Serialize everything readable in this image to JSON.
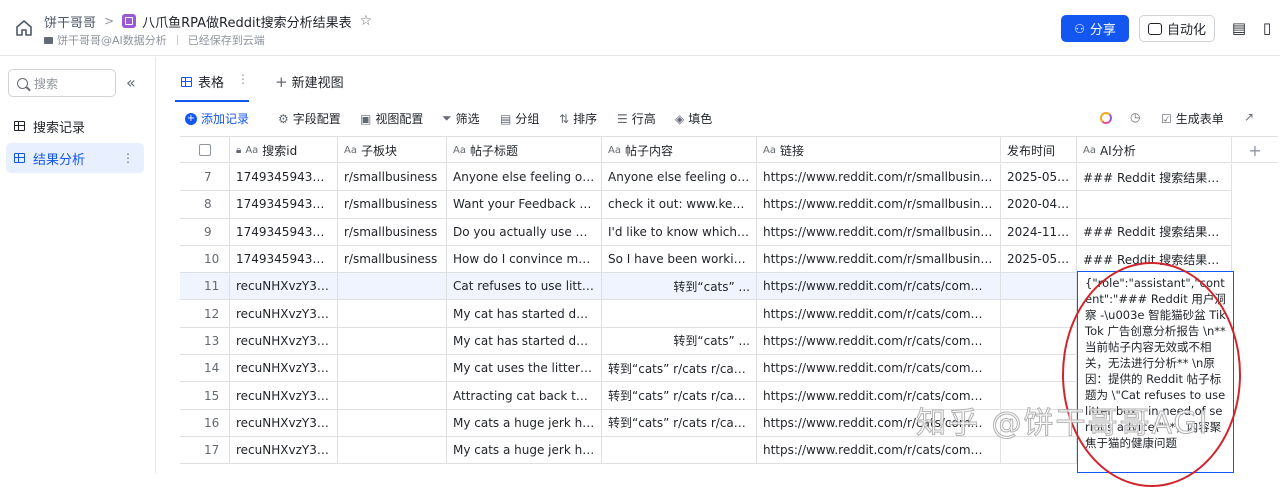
{
  "header": {
    "breadcrumb_parent": "饼干哥哥",
    "doc_title": "八爪鱼RPA做Reddit搜索分析结果表",
    "workspace": "饼干哥哥@AI数据分析",
    "save_status": "已经保存到云端",
    "share_label": "分享",
    "automation_label": "自动化",
    "accent": "#1456f0"
  },
  "sidebar": {
    "search_placeholder": "搜索",
    "items": [
      {
        "label": "搜索记录"
      },
      {
        "label": "结果分析"
      }
    ]
  },
  "tabs": {
    "table_label": "表格",
    "new_view_label": "新建视图"
  },
  "toolbar": {
    "add_record": "添加记录",
    "field_config": "字段配置",
    "view_config": "视图配置",
    "filter": "筛选",
    "group": "分组",
    "sort": "排序",
    "row_height": "行高",
    "fill_color": "填色",
    "generate_form": "生成表单"
  },
  "table": {
    "columns": [
      {
        "label": "搜索id",
        "type": "Aa"
      },
      {
        "label": "子板块",
        "type": "Aa"
      },
      {
        "label": "帖子标题",
        "type": "Aa"
      },
      {
        "label": "帖子内容",
        "type": "Aa"
      },
      {
        "label": "链接",
        "type": "Aa"
      },
      {
        "label": "发布时间",
        "type": ""
      },
      {
        "label": "AI分析",
        "type": "Aa"
      }
    ],
    "rows": [
      {
        "idx": "7",
        "search_id": "1749345943597",
        "subreddit": "r/smallbusiness",
        "title": "Anyone else feeling over...",
        "content": "Anyone else feeling over...",
        "link": "https://www.reddit.com/r/smallbusiness/...",
        "date": "2025-05-...",
        "ai": "### Reddit 搜索结果商..."
      },
      {
        "idx": "8",
        "search_id": "1749345943597",
        "subreddit": "r/smallbusiness",
        "title": "Want your Feedback - K...",
        "content": "check it out: www.keep...",
        "link": "https://www.reddit.com/r/smallbusiness/...",
        "date": "2020-04-...",
        "ai": ""
      },
      {
        "idx": "9",
        "search_id": "1749345943597",
        "subreddit": "r/smallbusiness",
        "title": "Do you actually use AI t...",
        "content": "I'd like to know which A...",
        "link": "https://www.reddit.com/r/smallbusiness/...",
        "date": "2024-11-...",
        "ai": "### Reddit 搜索结果商..."
      },
      {
        "idx": "10",
        "search_id": "1749345943597",
        "subreddit": "r/smallbusiness",
        "title": "How do I convince my b...",
        "content": "So I have been working ...",
        "link": "https://www.reddit.com/r/smallbusiness/...",
        "date": "2025-05-...",
        "ai": "### Reddit 搜索结果商..."
      },
      {
        "idx": "11",
        "search_id": "recuNHXvzY3sz5",
        "subreddit": "",
        "title": "Cat refuses to use litter ...",
        "content": "转到“cats” ...",
        "link": "https://www.reddit.com/r/cats/comment...",
        "date": "",
        "ai": ""
      },
      {
        "idx": "12",
        "search_id": "recuNHXvzY3sz5",
        "subreddit": "",
        "title": "My cat has started doin...",
        "content": "",
        "link": "https://www.reddit.com/r/cats/comment...",
        "date": "",
        "ai": ""
      },
      {
        "idx": "13",
        "search_id": "recuNHXvzY3sz5",
        "subreddit": "",
        "title": "My cat has started doin...",
        "content": "转到“cats” ...",
        "link": "https://www.reddit.com/r/cats/comment...",
        "date": "",
        "ai": ""
      },
      {
        "idx": "14",
        "search_id": "recuNHXvzY3sz5",
        "subreddit": "",
        "title": "My cat uses the litter bo...",
        "content": "转到“cats” r/cats r/cats ...",
        "link": "https://www.reddit.com/r/cats/comment...",
        "date": "",
        "ai": ""
      },
      {
        "idx": "15",
        "search_id": "recuNHXvzY3sz5",
        "subreddit": "",
        "title": "Attracting cat back to litt...",
        "content": "转到“cats” r/cats r/cats ...",
        "link": "https://www.reddit.com/r/cats/comment...",
        "date": "",
        "ai": ""
      },
      {
        "idx": "16",
        "search_id": "recuNHXvzY3sz5",
        "subreddit": "",
        "title": "My cats a huge jerk how...",
        "content": "转到“cats” r/cats r/cats ...",
        "link": "https://www.reddit.com/r/cats/comment...",
        "date": "",
        "ai": ""
      },
      {
        "idx": "17",
        "search_id": "recuNHXvzY3sz5",
        "subreddit": "",
        "title": "My cats a huge jerk how...",
        "content": "",
        "link": "https://www.reddit.com/r/cats/comment...",
        "date": "",
        "ai": ""
      }
    ],
    "expanded_ai_text": "{\"role\":\"assistant\",\"content\":\"### Reddit 用户洞察 -\\u003e 智能猫砂盆 TikTok 广告创意分析报告 \\n**当前帖子内容无效或不相关，无法进行分析** \\n原因：提供的 Reddit 帖子标题为 \\\"Cat refuses to use litter box - in need of serious advice\\\"**，内容聚焦于猫的健康问题"
  },
  "watermark": "知乎 @饼干哥哥AGI"
}
